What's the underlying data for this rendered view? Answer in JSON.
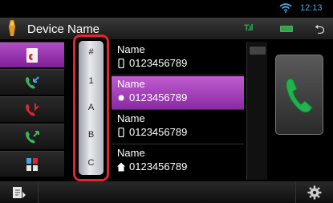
{
  "status": {
    "clock": "12:13"
  },
  "header": {
    "title": "Device Name",
    "signal": "T.ıl"
  },
  "sidebar": [
    {
      "icon": "phonebook-icon",
      "active": true
    },
    {
      "icon": "incoming-call-icon",
      "active": false
    },
    {
      "icon": "missed-call-icon",
      "active": false
    },
    {
      "icon": "outgoing-call-icon",
      "active": false
    },
    {
      "icon": "dial-pad-icon",
      "active": false
    }
  ],
  "index": [
    "#",
    "1",
    "A",
    "B",
    "C"
  ],
  "contacts": [
    {
      "name": "Name",
      "number": "0123456789",
      "type": "mobile-icon",
      "selected": false
    },
    {
      "name": "Name",
      "number": "0123456789",
      "type": "general-icon",
      "selected": true
    },
    {
      "name": "Name",
      "number": "0123456789",
      "type": "mobile-icon",
      "selected": false
    },
    {
      "name": "Name",
      "number": "0123456789",
      "type": "home-icon",
      "selected": false
    }
  ],
  "colors": {
    "accent": "#9a35b0",
    "highlight_border": "#e1252a",
    "call_green": "#2ea64e",
    "clock": "#3fb0e6"
  }
}
